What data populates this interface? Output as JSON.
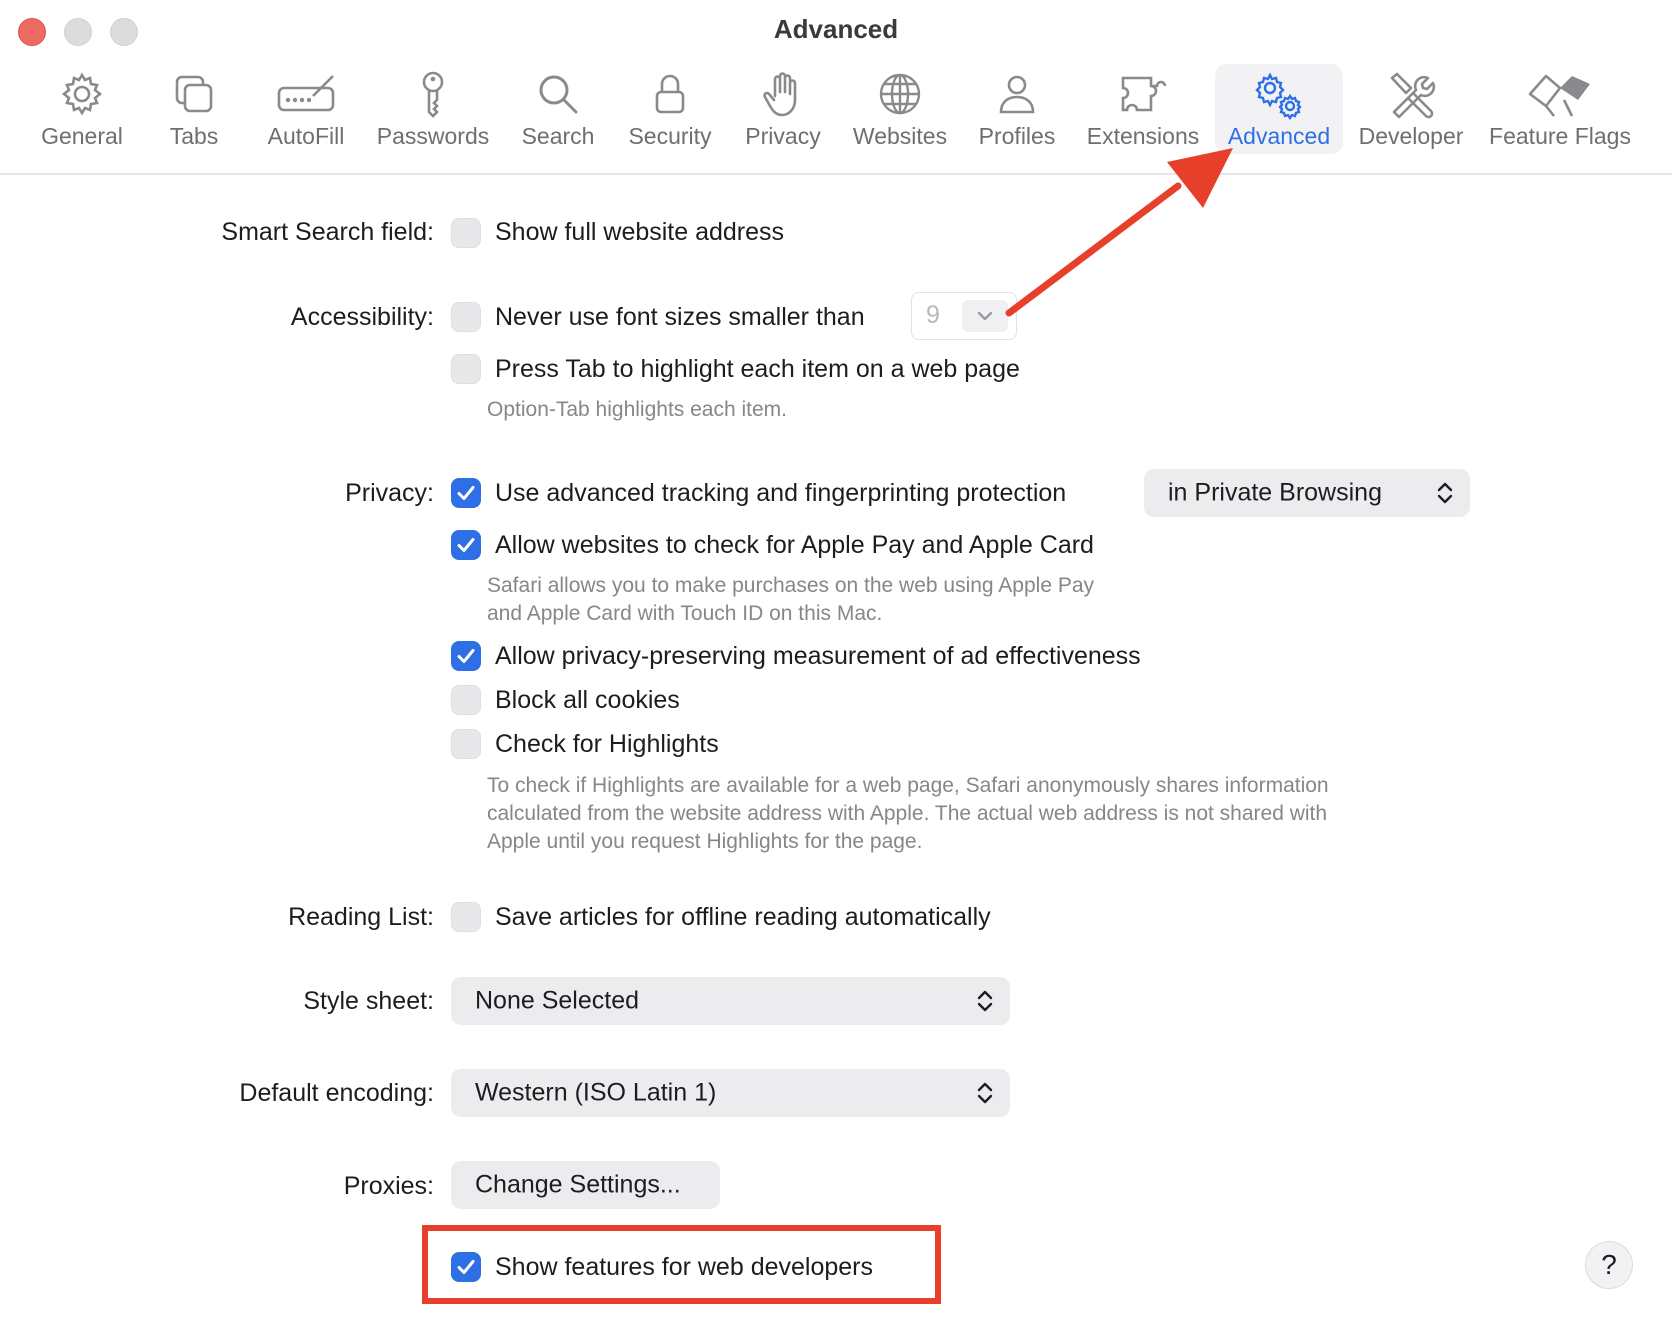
{
  "window": {
    "title": "Advanced"
  },
  "toolbar": {
    "items": [
      {
        "label": "General",
        "icon": "gear-icon"
      },
      {
        "label": "Tabs",
        "icon": "tabs-icon"
      },
      {
        "label": "AutoFill",
        "icon": "autofill-icon"
      },
      {
        "label": "Passwords",
        "icon": "key-icon"
      },
      {
        "label": "Search",
        "icon": "search-icon"
      },
      {
        "label": "Security",
        "icon": "lock-icon"
      },
      {
        "label": "Privacy",
        "icon": "hand-icon"
      },
      {
        "label": "Websites",
        "icon": "globe-icon"
      },
      {
        "label": "Profiles",
        "icon": "person-icon"
      },
      {
        "label": "Extensions",
        "icon": "puzzle-icon"
      },
      {
        "label": "Advanced",
        "icon": "gears-icon",
        "selected": true
      },
      {
        "label": "Developer",
        "icon": "tools-icon"
      },
      {
        "label": "Feature Flags",
        "icon": "flags-icon"
      }
    ]
  },
  "smart_search": {
    "label": "Smart Search field:",
    "option": "Show full website address",
    "checked": false
  },
  "accessibility": {
    "label": "Accessibility:",
    "font_option": "Never use font sizes smaller than",
    "font_checked": false,
    "font_size": "9",
    "tab_option": "Press Tab to highlight each item on a web page",
    "tab_checked": false,
    "tab_note": "Option-Tab highlights each item."
  },
  "privacy": {
    "label": "Privacy:",
    "tracking_option": "Use advanced tracking and fingerprinting protection",
    "tracking_checked": true,
    "tracking_scope": "in Private Browsing",
    "applepay_option": "Allow websites to check for Apple Pay and Apple Card",
    "applepay_checked": true,
    "applepay_note_line1": "Safari allows you to make purchases on the web using Apple Pay",
    "applepay_note_line2": "and Apple Card with Touch ID on this Mac.",
    "ad_option": "Allow privacy-preserving measurement of ad effectiveness",
    "ad_checked": true,
    "cookies_option": "Block all cookies",
    "cookies_checked": false,
    "highlights_option": "Check for Highlights",
    "highlights_checked": false,
    "highlights_note_line1": "To check if Highlights are available for a web page, Safari anonymously shares information",
    "highlights_note_line2": "calculated from the website address with Apple. The actual web address is not shared with",
    "highlights_note_line3": "Apple until you request Highlights for the page."
  },
  "reading_list": {
    "label": "Reading List:",
    "option": "Save articles for offline reading automatically",
    "checked": false
  },
  "style_sheet": {
    "label": "Style sheet:",
    "value": "None Selected"
  },
  "encoding": {
    "label": "Default encoding:",
    "value": "Western (ISO Latin 1)"
  },
  "proxies": {
    "label": "Proxies:",
    "button": "Change Settings..."
  },
  "developer": {
    "option": "Show features for web developers",
    "checked": true
  },
  "help": {
    "label": "?"
  },
  "colors": {
    "accent": "#2f6fe6",
    "annotation": "#e6402b"
  }
}
